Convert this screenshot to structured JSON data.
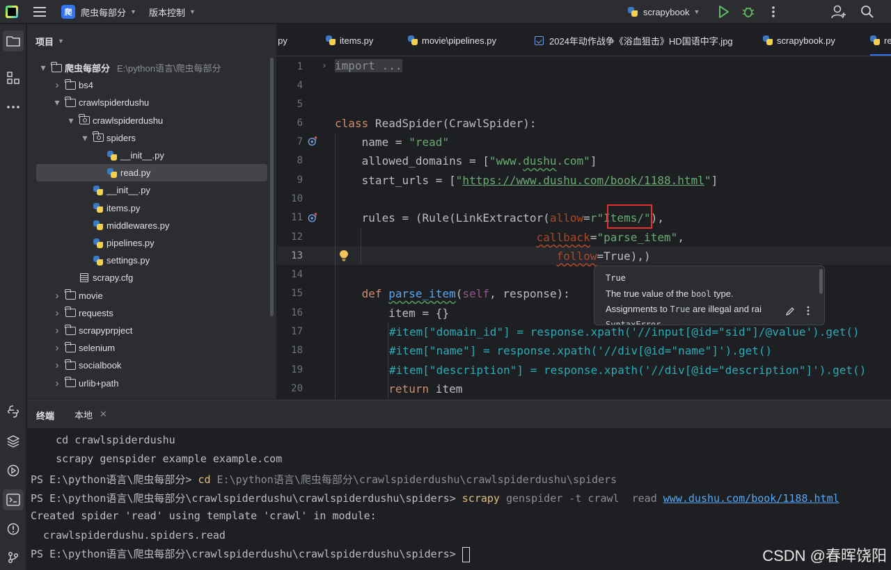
{
  "titlebar": {
    "project_badge": "爬",
    "project_name": "爬虫每部分",
    "vcs_label": "版本控制",
    "run_config": "scrapybook"
  },
  "project_panel": {
    "title": "项目",
    "tree": [
      {
        "label": "爬虫每部分",
        "path": "E:\\python语言\\爬虫每部分",
        "kind": "folder",
        "expanded": true
      },
      {
        "label": "bs4",
        "kind": "folder",
        "expanded": false
      },
      {
        "label": "crawlspiderdushu",
        "kind": "folder",
        "expanded": true
      },
      {
        "label": "crawlspiderdushu",
        "kind": "package",
        "expanded": true
      },
      {
        "label": "spiders",
        "kind": "package",
        "expanded": true
      },
      {
        "label": "__init__.py",
        "kind": "py"
      },
      {
        "label": "read.py",
        "kind": "py",
        "selected": true
      },
      {
        "label": "__init__.py",
        "kind": "py"
      },
      {
        "label": "items.py",
        "kind": "py"
      },
      {
        "label": "middlewares.py",
        "kind": "py"
      },
      {
        "label": "pipelines.py",
        "kind": "py"
      },
      {
        "label": "settings.py",
        "kind": "py"
      },
      {
        "label": "scrapy.cfg",
        "kind": "cfg"
      },
      {
        "label": "movie",
        "kind": "folder",
        "expanded": false
      },
      {
        "label": "requests",
        "kind": "folder",
        "expanded": false
      },
      {
        "label": "scrapyprpject",
        "kind": "folder",
        "expanded": false
      },
      {
        "label": "selenium",
        "kind": "folder",
        "expanded": false
      },
      {
        "label": "socialbook",
        "kind": "folder",
        "expanded": false
      },
      {
        "label": "urlib+path",
        "kind": "folder",
        "expanded": false
      }
    ]
  },
  "tabs": [
    {
      "label": "v.py"
    },
    {
      "label": "items.py"
    },
    {
      "label": "movie\\pipelines.py"
    },
    {
      "label": "2024年动作战争《浴血狙击》HD国语中字.jpg"
    },
    {
      "label": "scrapybook.py"
    },
    {
      "label": "re",
      "active": true
    }
  ],
  "editor": {
    "line_numbers": [
      "1",
      "4",
      "5",
      "6",
      "7",
      "8",
      "9",
      "10",
      "11",
      "12",
      "13",
      "14",
      "15",
      "16",
      "17",
      "18",
      "19",
      "20"
    ],
    "current_line": "13",
    "code": {
      "l1": "import ...",
      "l6_kw": "class",
      "l6_rest": " ReadSpider(CrawlSpider):",
      "l7_a": "    name = ",
      "l7_b": "\"read\"",
      "l8_a": "    allowed_domains = [",
      "l8_b": "\"www.",
      "l8_c": "dushu",
      "l8_d": ".com\"",
      "l8_e": "]",
      "l9_a": "    start_urls = [",
      "l9_b": "\"",
      "l9_c": "https://www.dushu.com/book/1188.html",
      "l9_d": "\"",
      "l9_e": "]",
      "l11_a": "    rules = (Rule(LinkExtractor(",
      "l11_b": "allow",
      "l11_c": "=",
      "l11_d": "r\"",
      "l11_e": "Items/",
      "l11_f": "\"",
      "l11_g": "),",
      "l12_a": "                              ",
      "l12_b": "callback",
      "l12_c": "=",
      "l12_d": "\"parse_item\"",
      "l12_e": ",",
      "l13_a": "                                 ",
      "l13_b": "follow",
      "l13_c": "=",
      "l13_d": "True",
      "l13_e": "),)",
      "l15_a": "    ",
      "l15_b": "def",
      "l15_c": " ",
      "l15_d": "parse_item",
      "l15_e": "(",
      "l15_f": "self",
      "l15_g": ", response):",
      "l16": "        item = {}",
      "l17": "#item[\"domain_id\"] = response.xpath('//input[@id=\"sid\"]/@value').get()",
      "l18": "#item[\"name\"] = response.xpath('//div[@id=\"name\"]').get()",
      "l19": "#item[\"description\"] = response.xpath('//div[@id=\"description\"]').get()",
      "l20_a": "        ",
      "l20_b": "return",
      "l20_c": " item"
    }
  },
  "tooltip": {
    "title": "True",
    "line1_a": "The true value of the ",
    "line1_code": "bool",
    "line1_b": " type.",
    "line2_a": "Assignments to ",
    "line2_code": "True",
    "line2_b": " are illegal and rai",
    "line3": "SyntaxError"
  },
  "terminal": {
    "tab_title": "终端",
    "tab_local": "本地",
    "lines": {
      "t1": "    cd crawlspiderdushu",
      "t2": "    scrapy genspider example example.com",
      "t3_prompt": "PS E:\\python语言\\爬虫每部分> ",
      "t3_cmd": "cd",
      "t3_arg": " E:\\python语言\\爬虫每部分\\crawlspiderdushu\\crawlspiderdushu\\spiders",
      "t4_prompt": "PS E:\\python语言\\爬虫每部分\\crawlspiderdushu\\crawlspiderdushu\\spiders> ",
      "t4_cmd": "scrapy",
      "t4_arg": " genspider -t crawl  read ",
      "t4_link": "www.dushu.com/book/1188.html",
      "t5": "Created spider 'read' using template 'crawl' in module:",
      "t6": "  crawlspiderdushu.spiders.read",
      "t7_prompt": "PS E:\\python语言\\爬虫每部分\\crawlspiderdushu\\crawlspiderdushu\\spiders> "
    }
  },
  "watermark": "CSDN @春晖饶阳"
}
